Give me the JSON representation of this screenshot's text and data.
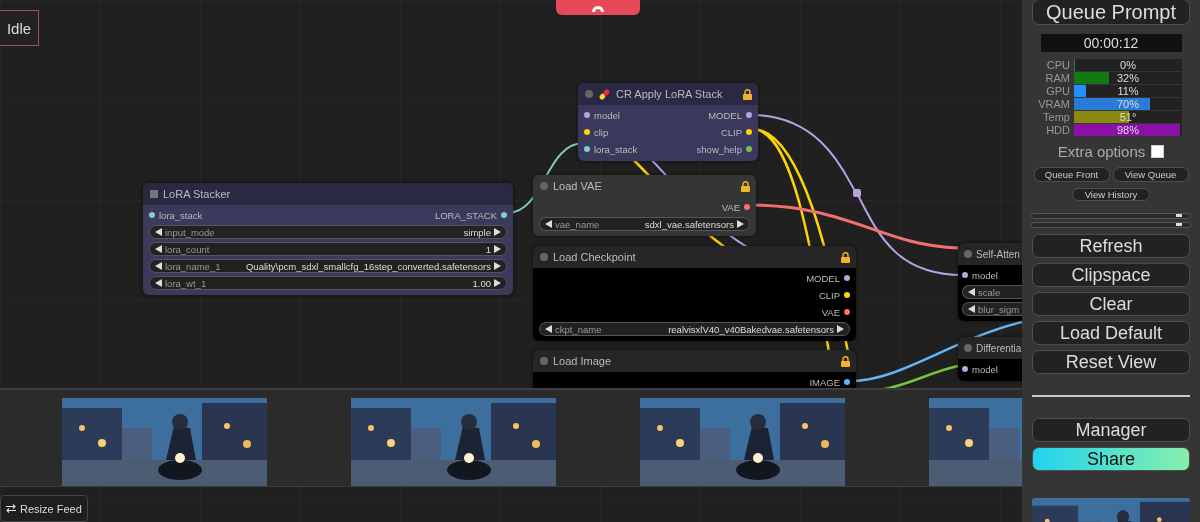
{
  "status": "Idle",
  "nodes": [
    {
      "title": "LoRA Stacker",
      "kind": "square",
      "icon": false,
      "locked": false,
      "color": "#3b395c",
      "inputs": [
        {
          "name": "lora_stack",
          "color": "#7fd1c0"
        }
      ],
      "outputs": [
        {
          "name": "LORA_STACK",
          "color": "#7fd1c0"
        }
      ],
      "widgets": [
        {
          "label": "input_mode",
          "value": "simple"
        },
        {
          "label": "lora_count",
          "value": "1"
        },
        {
          "label": "lora_name_1",
          "value": "Quality\\pcm_sdxl_smallcfg_16step_converted.safetensors"
        },
        {
          "label": "lora_wt_1",
          "value": "1.00"
        }
      ]
    },
    {
      "title": "CR Apply LoRA Stack",
      "kind": "round",
      "icon": true,
      "locked": true,
      "color": "#3a385c",
      "inputs": [
        {
          "name": "model",
          "color": "#b8a2e0"
        },
        {
          "name": "clip",
          "color": "#ffd500"
        },
        {
          "name": "lora_stack",
          "color": "#7fd1c0"
        }
      ],
      "outputs": [
        {
          "name": "MODEL",
          "color": "#b8a2e0"
        },
        {
          "name": "CLIP",
          "color": "#ffd500"
        },
        {
          "name": "show_help",
          "color": "#7ac142"
        }
      ]
    },
    {
      "title": "Load VAE",
      "kind": "round",
      "icon": false,
      "locked": true,
      "color": "#353535",
      "outputs": [
        {
          "name": "VAE",
          "color": "#ff6e6e"
        }
      ],
      "widgets": [
        {
          "label": "vae_name",
          "value": "sdxl_vae.safetensors"
        }
      ]
    },
    {
      "title": "Load Checkpoint",
      "kind": "round",
      "icon": false,
      "locked": true,
      "color": "#000000",
      "outputs": [
        {
          "name": "MODEL",
          "color": "#b8a2e0"
        },
        {
          "name": "CLIP",
          "color": "#ffd500"
        },
        {
          "name": "VAE",
          "color": "#ff6e6e"
        }
      ],
      "widgets": [
        {
          "label": "ckpt_name",
          "value": "realvisxlV40_v40Bakedvae.safetensors"
        }
      ]
    },
    {
      "title": "Load Image",
      "kind": "round",
      "icon": false,
      "locked": true,
      "color": "#000000",
      "outputs": [
        {
          "name": "IMAGE",
          "color": "#64b5f6"
        }
      ]
    },
    {
      "title": "Self-Atten",
      "kind": "round",
      "icon": false,
      "color": "#000000",
      "inputs": [
        {
          "name": "model",
          "color": "#b8a2e0"
        }
      ],
      "widgets": [
        {
          "label": "scale"
        },
        {
          "label": "blur_sigm"
        }
      ]
    },
    {
      "title": "Differentia",
      "kind": "round",
      "icon": false,
      "color": "#000000",
      "inputs": [
        {
          "name": "model",
          "color": "#b8a2e0"
        }
      ]
    }
  ],
  "feed": [
    {
      "kind": "picture"
    },
    {
      "kind": "picture"
    },
    {
      "kind": "picture"
    },
    {
      "kind": "picture"
    }
  ],
  "resize_button": "Resize Feed",
  "panel": {
    "queue_button": "Queue Prompt",
    "timer": "00:00:12",
    "stats": [
      {
        "label": "CPU",
        "value": "0%",
        "level": 0,
        "color": "#1a8a1a"
      },
      {
        "label": "RAM",
        "value": "32%",
        "level": 0.32,
        "color": "#137a13"
      },
      {
        "label": "GPU",
        "value": "11%",
        "level": 0.11,
        "color": "#1e90ff"
      },
      {
        "label": "VRAM",
        "value": "70%",
        "level": 0.7,
        "color": "#2a7ad8"
      },
      {
        "label": "Temp",
        "value": "51°",
        "level": 0.51,
        "color": "#8a8a10"
      },
      {
        "label": "HDD",
        "value": "98%",
        "level": 0.98,
        "color": "#8a10a8"
      }
    ],
    "extra_options": {
      "label": "Extra options",
      "checked": false
    },
    "queue_actions": [
      "Queue Front",
      "View Queue"
    ],
    "history_button": "View History",
    "sliders": [
      {
        "level": 0.93
      },
      {
        "level": 0.93
      }
    ],
    "menu_buttons": [
      "Refresh",
      "Clipspace",
      "Clear",
      "Load Default",
      "Reset View"
    ],
    "extension_buttons": [
      {
        "label": "Manager",
        "kind": "plain"
      },
      {
        "label": "Share",
        "kind": "gradient"
      }
    ],
    "preview": {
      "kind": "picture"
    }
  }
}
